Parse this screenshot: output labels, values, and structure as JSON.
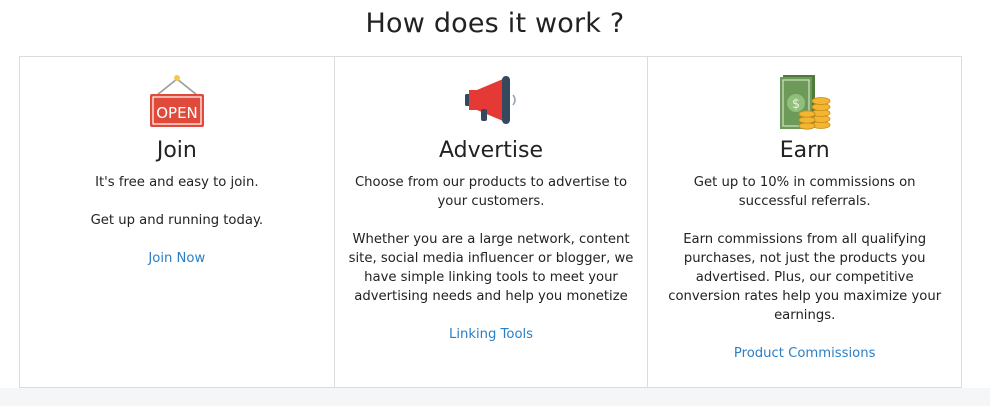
{
  "heading": "How does it work ?",
  "cards": [
    {
      "icon": "open-sign-icon",
      "title": "Join",
      "paragraphs": [
        "It's free and easy to join.",
        "Get up and running today."
      ],
      "link": "Join Now"
    },
    {
      "icon": "megaphone-icon",
      "title": "Advertise",
      "paragraphs": [
        "Choose from our products to advertise to your customers.",
        "Whether you are a large network, content site, social media influencer or blogger, we have simple linking tools to meet your advertising needs and help you monetize"
      ],
      "link": "Linking Tools"
    },
    {
      "icon": "money-coins-icon",
      "title": "Earn",
      "paragraphs": [
        "Get up to 10% in commissions on successful referrals.",
        "Earn commissions from all qualifying purchases, not just the products you advertised. Plus, our competitive conversion rates help you maximize your earnings."
      ],
      "link": "Product Commissions"
    }
  ],
  "colors": {
    "link": "#2a7fc6",
    "border": "#dcdcdc",
    "sign_red": "#e04a3b",
    "megaphone_red": "#e53935",
    "megaphone_navy": "#34495e",
    "cash_green": "#6e9a59",
    "coin_gold": "#f2b632"
  }
}
